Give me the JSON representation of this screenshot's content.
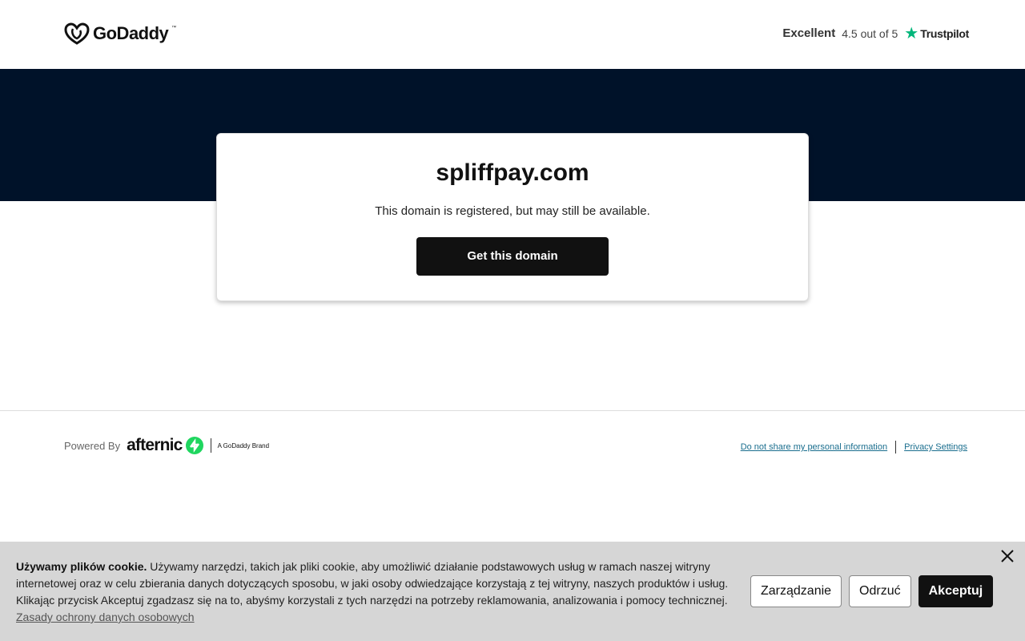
{
  "header": {
    "logo_text": "GoDaddy",
    "logo_icon": "godaddy-heart-icon",
    "rating": {
      "label": "Excellent",
      "score": "4.5 out of 5",
      "star_icon": "star-icon",
      "brand": "Trustpilot"
    }
  },
  "card": {
    "domain": "spliffpay.com",
    "message": "This domain is registered, but may still be available.",
    "cta_label": "Get this domain"
  },
  "footer": {
    "powered_by": "Powered By",
    "afternic": "afternic",
    "afternic_icon": "afternic-arrows-icon",
    "brand_line": "A GoDaddy Brand",
    "links": [
      "Do not share my personal information",
      "Privacy Settings"
    ]
  },
  "cookie": {
    "heading": "Używamy plików cookie.",
    "body": " Używamy narzędzi, takich jak pliki cookie, aby umożliwić działanie podstawowych usług w ramach naszej witryny internetowej oraz w celu zbierania danych dotyczących sposobu, w jaki osoby odwiedzające korzystają z tej witryny, naszych produktów i usług. Klikając przycisk Akceptuj zgadzasz się na to, abyśmy korzystali z tych narzędzi na potrzeby reklamowania, analizowania i pomocy technicznej.",
    "policy_link": "Zasady ochrony danych osobowych",
    "buttons": [
      "Zarządzanie",
      "Odrzuć",
      "Akceptuj"
    ],
    "close_icon": "close-icon"
  },
  "colors": {
    "banner": "#001229",
    "trustpilot_green": "#00b67a",
    "afternic_green": "#1fd65f",
    "link": "#1a6e8e"
  }
}
